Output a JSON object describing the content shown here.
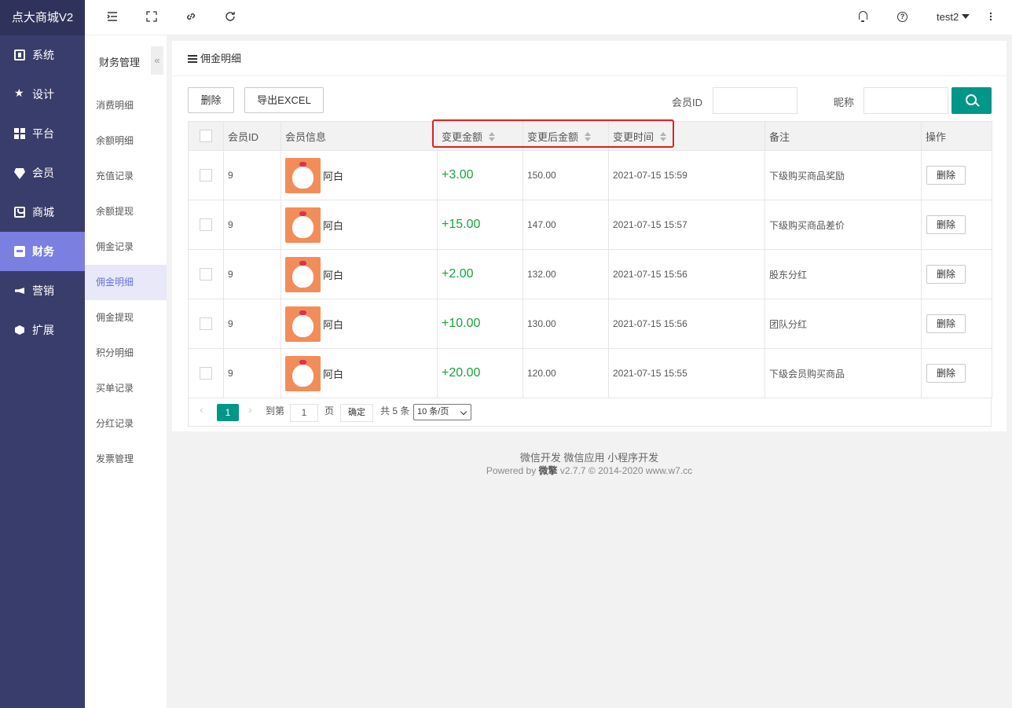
{
  "app": {
    "logo": "点大商城V2"
  },
  "sidebar": {
    "items": [
      {
        "label": "系统",
        "icon": "monitor-icon"
      },
      {
        "label": "设计",
        "icon": "puzzle-icon"
      },
      {
        "label": "平台",
        "icon": "grid-icon"
      },
      {
        "label": "会员",
        "icon": "diamond-icon"
      },
      {
        "label": "商城",
        "icon": "shop-icon"
      },
      {
        "label": "财务",
        "icon": "wallet-icon",
        "active": true
      },
      {
        "label": "营销",
        "icon": "megaphone-icon"
      },
      {
        "label": "扩展",
        "icon": "cube-icon"
      }
    ]
  },
  "submenu": {
    "title": "财务管理",
    "collapse_glyph": "«",
    "items": [
      "消费明细",
      "余额明细",
      "充值记录",
      "余额提现",
      "佣金记录",
      "佣金明细",
      "佣金提现",
      "积分明细",
      "买单记录",
      "分红记录",
      "发票管理"
    ],
    "active_index": 5
  },
  "topbar": {
    "icons": [
      "indent-icon",
      "fullscreen-icon",
      "link-icon",
      "refresh-icon",
      "bell-icon",
      "help-icon",
      "more-icon"
    ],
    "help_glyph": "?",
    "user": "test2"
  },
  "card": {
    "title": "佣金明细",
    "toolbar": {
      "delete_label": "删除",
      "export_label": "导出EXCEL"
    },
    "filters": {
      "member_id_label": "会员ID",
      "member_id_value": "",
      "nickname_label": "昵称",
      "nickname_value": ""
    },
    "table": {
      "headers": [
        "会员ID",
        "会员信息",
        "变更金额",
        "变更后金额",
        "变更时间",
        "备注",
        "操作"
      ],
      "rows": [
        {
          "id": "9",
          "name": "阿白",
          "change": "+3.00",
          "after": "150.00",
          "time": "2021-07-15 15:59",
          "remark": "下级购买商品奖励",
          "action": "删除"
        },
        {
          "id": "9",
          "name": "阿白",
          "change": "+15.00",
          "after": "147.00",
          "time": "2021-07-15 15:57",
          "remark": "下级购买商品差价",
          "action": "删除"
        },
        {
          "id": "9",
          "name": "阿白",
          "change": "+2.00",
          "after": "132.00",
          "time": "2021-07-15 15:56",
          "remark": "股东分红",
          "action": "删除"
        },
        {
          "id": "9",
          "name": "阿白",
          "change": "+10.00",
          "after": "130.00",
          "time": "2021-07-15 15:56",
          "remark": "团队分红",
          "action": "删除"
        },
        {
          "id": "9",
          "name": "阿白",
          "change": "+20.00",
          "after": "120.00",
          "time": "2021-07-15 15:55",
          "remark": "下级会员购买商品",
          "action": "删除"
        }
      ]
    },
    "pager": {
      "prev": "‹",
      "next": "›",
      "current": "1",
      "goto_label": "到第",
      "goto_value": "1",
      "page_label": "页",
      "ok_label": "确定",
      "total": "共 5 条",
      "per_page": "10 条/页"
    }
  },
  "footer": {
    "links": "微信开发 微信应用 小程序开发",
    "powered_by": "Powered by",
    "brand": "微擎",
    "version": "v2.7.7 © 2014-2020 www.w7.cc"
  },
  "colors": {
    "sidebar_bg": "#393d6b",
    "active_nav": "#7a7fe0",
    "primary": "#009688",
    "amount_green": "#19a33a",
    "highlight": "#e02020"
  }
}
